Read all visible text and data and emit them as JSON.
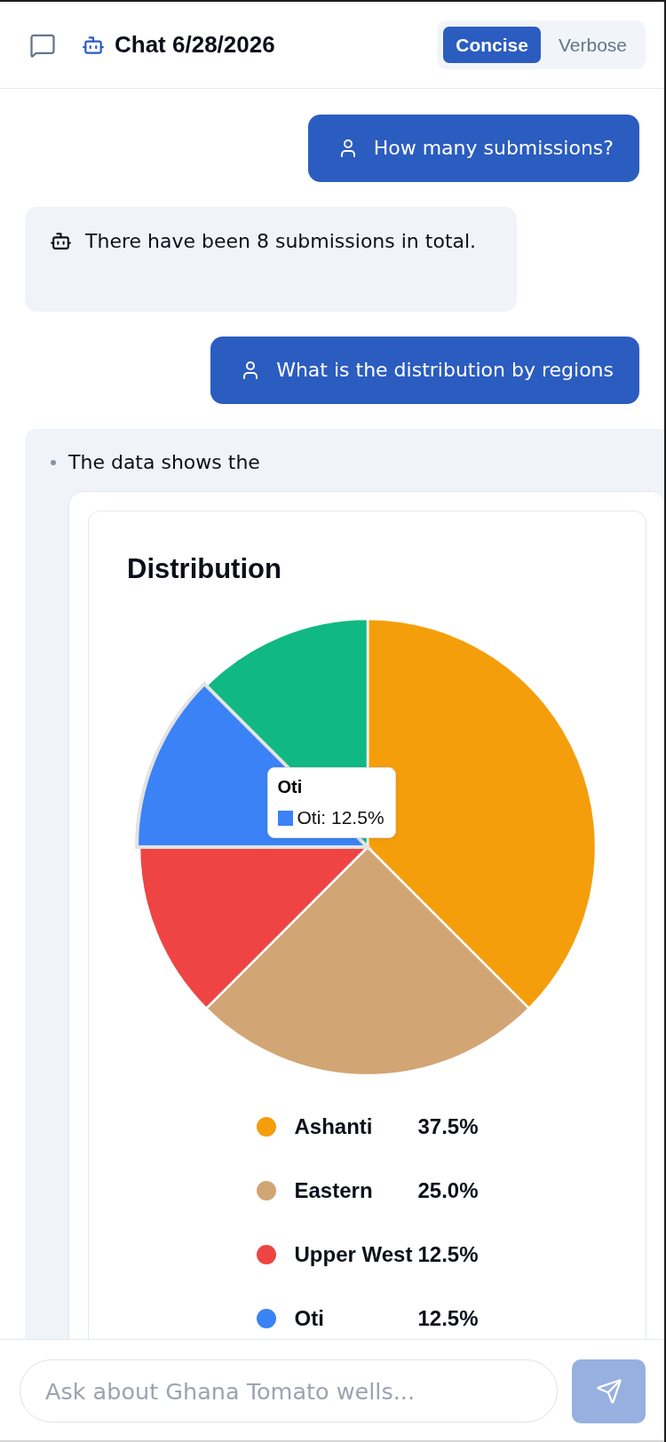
{
  "header": {
    "title": "Chat 6/28/2026",
    "modes": [
      {
        "label": "Concise",
        "selected": true
      },
      {
        "label": "Verbose",
        "selected": false
      }
    ]
  },
  "messages": [
    {
      "kind": "user",
      "text": "How many submissions?"
    },
    {
      "kind": "bot",
      "text": "There have been 8 submissions in total."
    },
    {
      "kind": "user",
      "text": "What is the distribution by regions"
    },
    {
      "kind": "chart",
      "text": "The data shows the",
      "chart_data": {
        "type": "pie",
        "title": "Distribution",
        "categories": [
          "Ashanti",
          "Eastern",
          "Upper West",
          "Oti",
          null
        ],
        "series": [
          {
            "values": [
              37.5,
              25.0,
              12.5,
              12.5,
              12.5
            ]
          }
        ]
      },
      "slices": [
        {
          "color": "#f59e0b",
          "selected": false
        },
        {
          "color": "#d2a574",
          "selected": false
        },
        {
          "color": "#ef4444",
          "selected": false
        },
        {
          "color": "#3b82f6",
          "selected": true
        },
        {
          "color": "#10b981",
          "selected": false
        }
      ],
      "tooltip": {
        "title": "Oti",
        "text": "Oti: 12.5%"
      },
      "legend": [
        {
          "value": "37.5%",
          "color": "#f59e0b"
        },
        {
          "value": "25.0%",
          "color": "#d2a574"
        },
        {
          "value": "12.5%",
          "color": "#ef4444"
        },
        {
          "value": "12.5%",
          "color": "#3b82f6"
        }
      ]
    }
  ],
  "composer": {
    "placeholder": "Ask about Ghana Tomato wells...",
    "send_button": {
      "disabled": true
    }
  }
}
